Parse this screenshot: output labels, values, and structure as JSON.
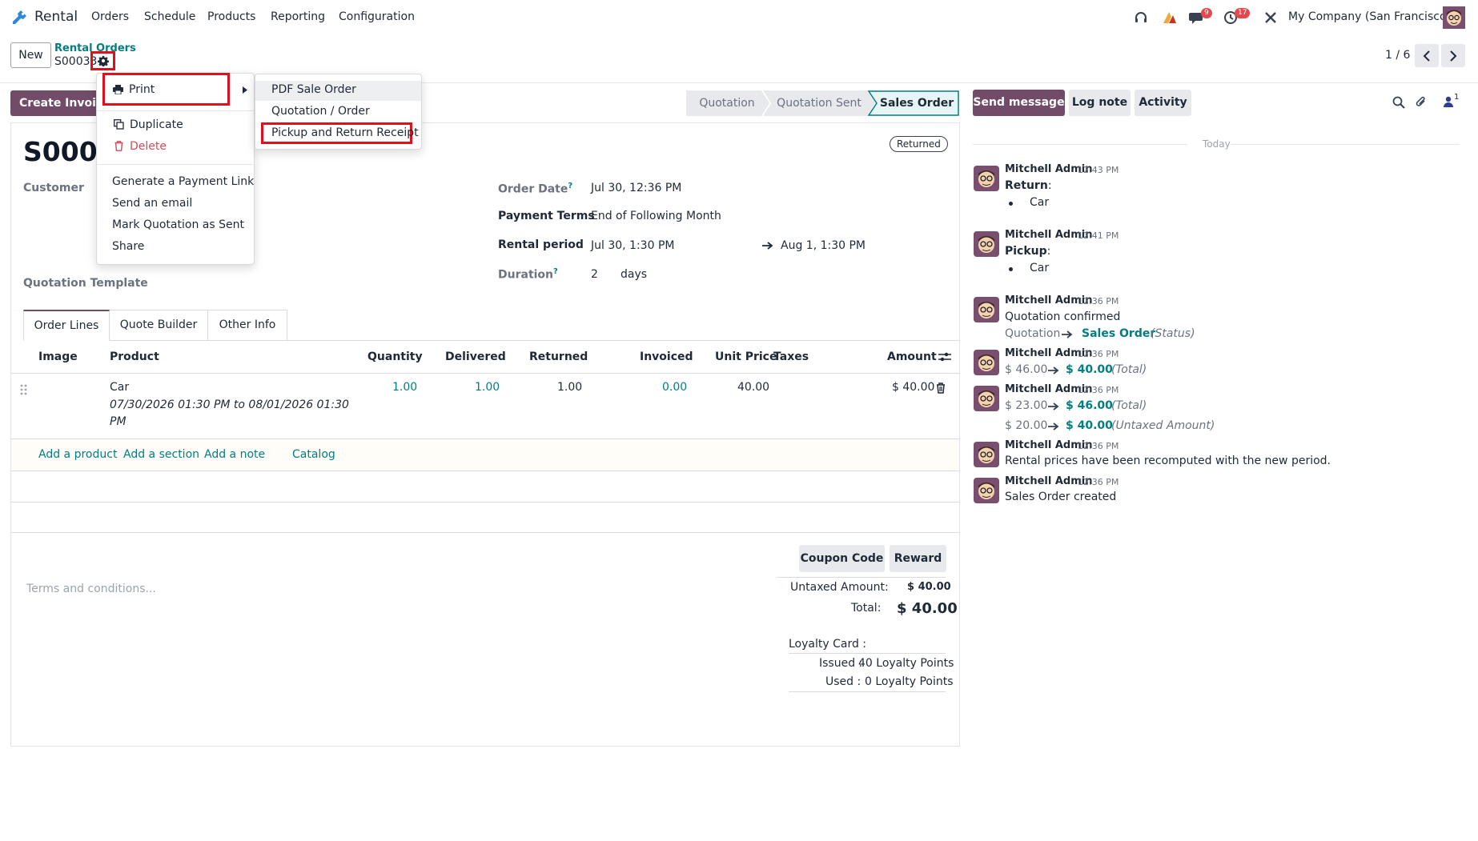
{
  "navbar": {
    "app_name": "Rental",
    "menus": [
      "Orders",
      "Schedule",
      "Products",
      "Reporting",
      "Configuration"
    ],
    "messages_badge": "9",
    "activities_badge": "17",
    "company": "My Company (San Francisco)"
  },
  "control_panel": {
    "new_label": "New",
    "breadcrumb_parent": "Rental Orders",
    "record_name": "S00033",
    "pager": "1 / 6"
  },
  "action_menu": {
    "print": "Print",
    "duplicate": "Duplicate",
    "delete": "Delete",
    "generate_payment_link": "Generate a Payment Link",
    "send_email": "Send an email",
    "mark_sent": "Mark Quotation as Sent",
    "share": "Share"
  },
  "print_submenu": {
    "items": [
      "PDF Sale Order",
      "Quotation / Order",
      "Pickup and Return Receipt"
    ]
  },
  "buttons": {
    "create_invoice": "Create Invoice"
  },
  "statusbar": {
    "stages": [
      "Quotation",
      "Quotation Sent",
      "Sales Order"
    ],
    "active": "Sales Order"
  },
  "form": {
    "title": "S0003",
    "ribbon": "Returned",
    "customer_label": "Customer",
    "quotation_template_label": "Quotation Template",
    "order_date_label": "Order Date",
    "order_date_value": "Jul 30, 12:36 PM",
    "payment_terms_label": "Payment Terms",
    "payment_terms_value": "End of Following Month",
    "rental_period_label": "Rental period",
    "rental_start": "Jul 30, 1:30 PM",
    "rental_end": "Aug 1, 1:30 PM",
    "duration_label": "Duration",
    "duration_value": "2",
    "duration_unit": "days",
    "tooltip_mark": "?"
  },
  "tabs": [
    "Order Lines",
    "Quote Builder",
    "Other Info"
  ],
  "table": {
    "headers": [
      "Image",
      "Product",
      "Quantity",
      "Delivered",
      "Returned",
      "Invoiced",
      "Unit Price",
      "Taxes",
      "Amount"
    ],
    "rows": [
      {
        "product": "Car",
        "description_1": "07/30/2026 01:30 PM to 08/01/2026 01:30",
        "description_2": "PM",
        "quantity": "1.00",
        "delivered": "1.00",
        "returned": "1.00",
        "invoiced": "0.00",
        "unit_price": "40.00",
        "amount": "$ 40.00"
      }
    ],
    "add_links": [
      "Add a product",
      "Add a section",
      "Add a note",
      "Catalog"
    ]
  },
  "footer": {
    "terms_placeholder": "Terms and conditions...",
    "coupon_code": "Coupon Code",
    "reward": "Reward",
    "untaxed_label": "Untaxed Amount:",
    "untaxed_value": "$ 40.00",
    "total_label": "Total:",
    "total_value": "$ 40.00",
    "loyalty_label": "Loyalty Card :",
    "issued_label": "Issued :",
    "issued_value": "40 Loyalty Points",
    "used_label": "Used :",
    "used_value": "0 Loyalty Points"
  },
  "chatter": {
    "send_message": "Send message",
    "log_note": "Log note",
    "activity": "Activity",
    "followers_count": "1",
    "date_separator": "Today",
    "messages": [
      {
        "author": "Mitchell Admin",
        "time": "12:43 PM",
        "title": "Return",
        "item": "Car"
      },
      {
        "author": "Mitchell Admin",
        "time": "12:41 PM",
        "title": "Pickup",
        "item": "Car"
      },
      {
        "author": "Mitchell Admin",
        "time": "12:36 PM",
        "body": "Quotation confirmed",
        "old": "Quotation",
        "new": "Sales Order",
        "field": "(Status)"
      },
      {
        "author": "Mitchell Admin",
        "time": "12:36 PM",
        "old": "$ 46.00",
        "new": "$ 40.00",
        "field": "(Total)"
      },
      {
        "author": "Mitchell Admin",
        "time": "12:36 PM",
        "old": "$ 23.00",
        "new": "$ 46.00",
        "field": "(Total)",
        "old2": "$ 20.00",
        "new2": "$ 40.00",
        "field2": "(Untaxed Amount)"
      },
      {
        "author": "Mitchell Admin",
        "time": "12:36 PM",
        "body": "Rental prices have been recomputed with the new period."
      },
      {
        "author": "Mitchell Admin",
        "time": "12:36 PM",
        "body": "Sales Order created"
      }
    ]
  },
  "colors": {
    "brand": "#714b67",
    "link": "#017e84",
    "highlight": "#e0101d",
    "danger": "#d44c59"
  }
}
